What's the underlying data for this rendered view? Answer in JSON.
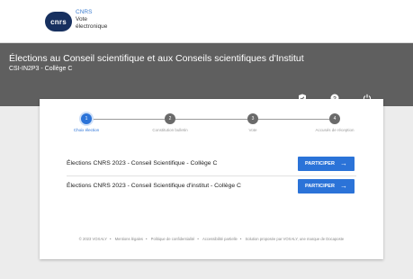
{
  "header": {
    "logo_text": "cnrs",
    "brand": "CNRS",
    "product_line1": "Vote",
    "product_line2": "électronique"
  },
  "banner": {
    "title": "Élections au Conseil scientifique et aux Conseils scientifiques d'Institut",
    "subtitle": "CSI-IN2P3 - Collège C",
    "icons": [
      "shield-check-icon",
      "help-icon",
      "power-icon"
    ]
  },
  "steps": [
    {
      "number": "1",
      "label": "Choix élection",
      "active": true
    },
    {
      "number": "2",
      "label": "Constitution bulletin",
      "active": false
    },
    {
      "number": "3",
      "label": "Vote",
      "active": false
    },
    {
      "number": "4",
      "label": "Accusés de réception",
      "active": false
    }
  ],
  "elections": [
    {
      "name": "Élections CNRS 2023 - Conseil Scientifique - Collège C",
      "button": "PARTICIPER"
    },
    {
      "name": "Élections CNRS 2023 - Conseil Scientifique d'institut - Collège C",
      "button": "PARTICIPER"
    }
  ],
  "footer": {
    "copyright": "© 2023 VOXALY",
    "legal": "Mentions légales",
    "privacy": "Politique de confidentialité",
    "accessibility": "Accessibilité partielle",
    "solution": "Solution proposée par VOXALY, une marque de Docaposte"
  },
  "colors": {
    "accent": "#2b73d8",
    "banner": "#5f5f5f",
    "brand_logo": "#17305f"
  }
}
